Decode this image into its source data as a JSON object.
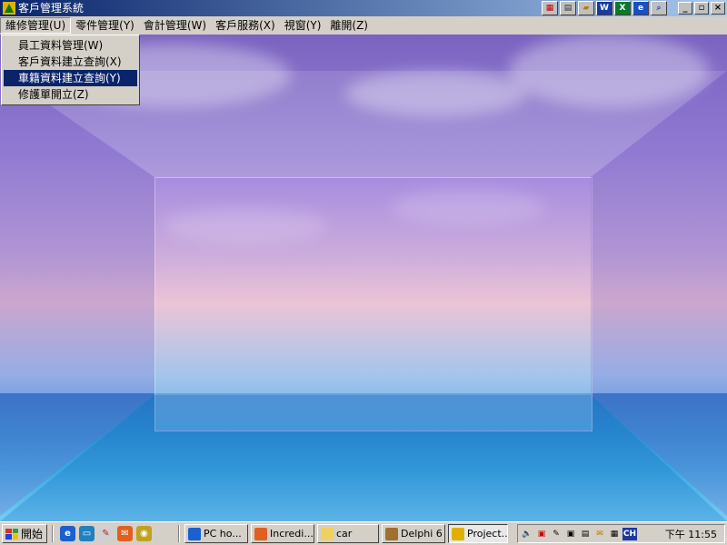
{
  "window": {
    "title": "客戶管理系統"
  },
  "toolbar_icons": [
    {
      "name": "palette-icon",
      "glyph": "▦"
    },
    {
      "name": "notes-icon",
      "glyph": "▤"
    },
    {
      "name": "folder-icon",
      "glyph": "▰"
    },
    {
      "name": "word-icon",
      "glyph": "W"
    },
    {
      "name": "excel-icon",
      "glyph": "X"
    },
    {
      "name": "ie-icon",
      "glyph": "e"
    },
    {
      "name": "magnifier-icon",
      "glyph": "⌕"
    }
  ],
  "window_buttons": {
    "minimize": "_",
    "maximize": "▫",
    "close": "×"
  },
  "menu": [
    {
      "label": "維修管理(U)"
    },
    {
      "label": "零件管理(Y)"
    },
    {
      "label": "會計管理(W)"
    },
    {
      "label": "客戶服務(X)"
    },
    {
      "label": "視窗(Y)"
    },
    {
      "label": "離開(Z)"
    }
  ],
  "dropdown": [
    {
      "label": "員工資料管理(W)"
    },
    {
      "label": "客戶資料建立查詢(X)"
    },
    {
      "label": "車籍資料建立查詢(Y)"
    },
    {
      "label": "修護單開立(Z)"
    }
  ],
  "taskbar": {
    "start_label": "開始",
    "tasks": [
      {
        "label": "PC ho..."
      },
      {
        "label": "Incredi..."
      },
      {
        "label": "car"
      },
      {
        "label": "Delphi 6"
      },
      {
        "label": "Project..."
      }
    ],
    "tray_lang": "CH",
    "clock": "下午 11:55"
  },
  "colors": {
    "title_bar": "#0a246a",
    "menu_highlight": "#0a246a",
    "chrome": "#d4d0c8"
  }
}
